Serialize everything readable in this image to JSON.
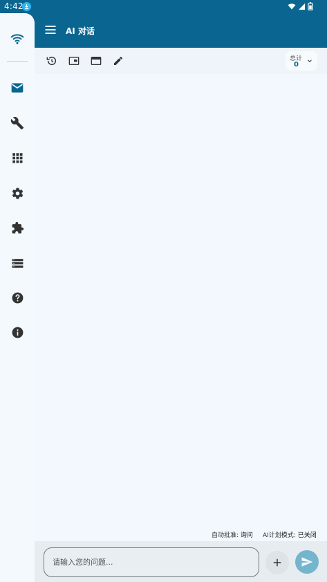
{
  "status_bar": {
    "time": "4:42"
  },
  "app_bar": {
    "title": "AI 对话"
  },
  "nav_rail": {
    "items": [
      {
        "name": "wifi",
        "icon": "wifi-icon"
      },
      {
        "name": "messages",
        "icon": "mail-icon",
        "selected": true
      },
      {
        "name": "tools",
        "icon": "wrench-icon"
      },
      {
        "name": "apps",
        "icon": "grid-icon"
      },
      {
        "name": "settings",
        "icon": "gear-icon"
      },
      {
        "name": "extensions",
        "icon": "puzzle-icon"
      },
      {
        "name": "list",
        "icon": "list-icon"
      },
      {
        "name": "help",
        "icon": "help-icon"
      },
      {
        "name": "info",
        "icon": "info-icon"
      }
    ]
  },
  "toolbar": {
    "tools": [
      "history-icon",
      "picture-in-picture-icon",
      "window-icon",
      "edit-icon"
    ],
    "total_label": "总计",
    "total_value": "0"
  },
  "status": {
    "auto_approve_label": "自动批准:",
    "auto_approve_value": "询问",
    "plan_mode_label": "AI计划模式:",
    "plan_mode_value": "已关闭"
  },
  "composer": {
    "placeholder": "请输入您的问题..."
  },
  "colors": {
    "primary": "#0a6690",
    "rail_bg": "#f3f9fd",
    "send_button": "#74b5cd"
  }
}
